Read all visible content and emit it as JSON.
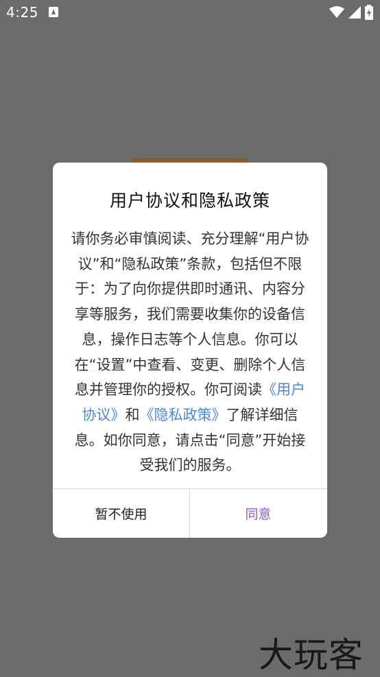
{
  "status_bar": {
    "time": "4:25",
    "notification_icon": "app-notification-icon",
    "wifi_icon": "wifi-icon",
    "signal_icon": "signal-icon",
    "battery_icon": "battery-charging-icon"
  },
  "dialog": {
    "title": "用户协议和隐私政策",
    "body_prefix": "请你务必审慎阅读、充分理解“用户协议”和“隐私政策”条款，包括但不限于：为了向你提供即时通讯、内容分享等服务，我们需要收集你的设备信息，操作日志等个人信息。你可以在“设置”中查看、变更、删除个人信息并管理你的授权。你可阅读",
    "user_agreement_link": "《用户协议》",
    "connector": "和",
    "privacy_policy_link": "《隐私政策》",
    "body_suffix": "了解详细信息。如你同意，请点击“同意”开始接受我们的服务。",
    "decline_label": "暂不使用",
    "agree_label": "同意"
  },
  "watermark": "大玩客",
  "colors": {
    "overlay": "#6b6b6b",
    "link": "#4a86e8",
    "agree": "#8a5cd1"
  }
}
